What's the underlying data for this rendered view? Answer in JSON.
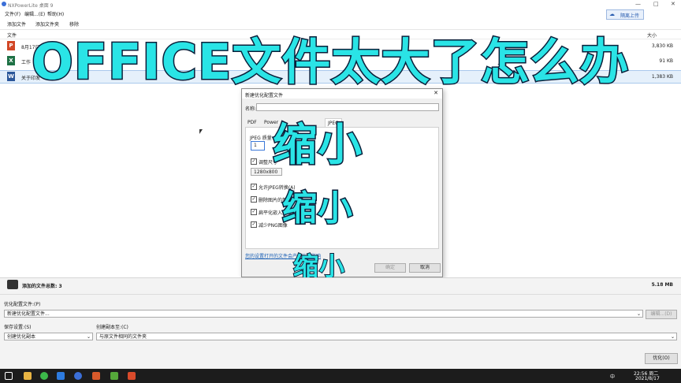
{
  "window": {
    "title": "NXPowerLite 桌面 9",
    "minimize": "—",
    "maximize": "□",
    "close": "✕"
  },
  "menu": [
    "文件(F)",
    "编辑...(E)",
    "帮助(H)"
  ],
  "toolbar": {
    "add_file": "添加文件",
    "add_folder": "添加文件夹",
    "remove": "移除",
    "upload": "隔离上传"
  },
  "columns": {
    "file": "文件",
    "size": "大小"
  },
  "files": [
    {
      "name": "8月17日",
      "size": "3,830 KB",
      "type": "ppt",
      "color": "#d24726"
    },
    {
      "name": "工作",
      "size": "91 KB",
      "type": "xls",
      "color": "#1e7145"
    },
    {
      "name": "关于印发",
      "size": "1,383 KB",
      "type": "doc",
      "color": "#2b579a"
    }
  ],
  "overlay": {
    "headline": "OFFICE文件太大了怎么办",
    "shrink1": "缩小",
    "shrink2": "缩小",
    "shrink3": "缩小"
  },
  "dialog": {
    "title": "新建优化配置文件",
    "name_label": "名称:",
    "name_value": "",
    "tabs": [
      "PDF",
      "Power",
      "JPEG"
    ],
    "jpeg_quality_label": "JPEG 质量",
    "jpeg_quality_value": "1",
    "resize_label": "调整尺寸",
    "resize_value": "1280x800",
    "options": [
      "允许JPEG转换(A)",
      "删除图片的剪切",
      "扁平化嵌入对象",
      "减少PNG图像"
    ],
    "link": "您的设置打开的文件会产生什么影响",
    "ok": "确定",
    "cancel": "取消",
    "close": "✕"
  },
  "summary": {
    "label": "添加的文件总数: 3",
    "total": "5.18 MB"
  },
  "settings": {
    "profile_label": "优化配置文件:(P)",
    "profile_value": "新建优化配置文件...",
    "edit_button": "编辑...(D)",
    "save_label": "保存设置:(S)",
    "save_value": "创建优化副本",
    "copy_label": "创建副本至:(C)",
    "copy_value": "与原文件相同的文件夹",
    "optimize_button": "优化(O)"
  },
  "taskbar": {
    "time": "22:56 周二",
    "date": "2021/8/17",
    "ime": "中"
  },
  "colors": {
    "accent": "#2ae4e6",
    "stroke": "#0a1f3a",
    "taskbar": "#1c1c1c"
  }
}
